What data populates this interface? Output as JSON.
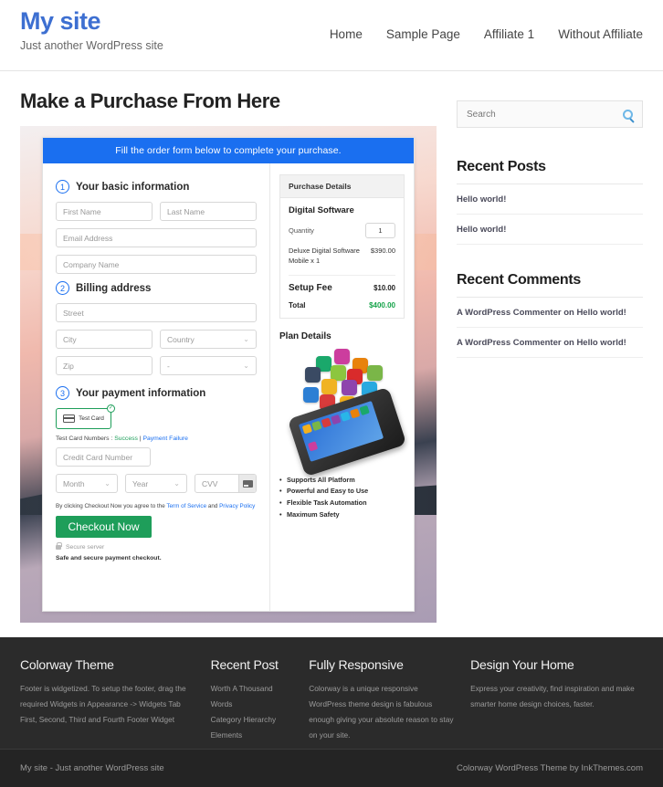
{
  "header": {
    "site_title": "My site",
    "tagline": "Just another WordPress site",
    "nav": [
      {
        "label": "Home"
      },
      {
        "label": "Sample Page"
      },
      {
        "label": "Affiliate 1"
      },
      {
        "label": "Without Affiliate"
      }
    ]
  },
  "page": {
    "title": "Make a Purchase From Here"
  },
  "form": {
    "banner": "Fill the order form below to complete your purchase.",
    "step1": {
      "number": "1",
      "label": "Your basic information",
      "first_name": "First Name",
      "last_name": "Last Name",
      "email": "Email Address",
      "company": "Company Name"
    },
    "step2": {
      "number": "2",
      "label": "Billing address",
      "street": "Street",
      "city": "City",
      "country": "Country",
      "zip": "Zip",
      "state": "-"
    },
    "step3": {
      "number": "3",
      "label": "Your payment information",
      "test_card_button": "Test Card",
      "test_card_badge": "✓",
      "test_numbers_label": "Test Card Numbers :",
      "success_link": "Success",
      "separator": "|",
      "failure_link": "Payment Failure",
      "credit_card_number": "Credit Card Number",
      "month": "Month",
      "year": "Year",
      "cvv": "CVV"
    },
    "terms_prefix": "By clicking Checkout Now you agree to the",
    "terms_link": "Term of Service",
    "terms_and": "and",
    "privacy_link": "Privacy Policy",
    "checkout_button": "Checkout Now",
    "secure_server": "Secure server",
    "safe_note": "Safe and secure payment checkout."
  },
  "purchase_details": {
    "header": "Purchase Details",
    "product_title": "Digital Software",
    "quantity_label": "Quantity",
    "quantity_value": "1",
    "item_name": "Deluxe Digital Software Mobile x 1",
    "item_price": "$390.00",
    "setup_fee_label": "Setup Fee",
    "setup_fee_value": "$10.00",
    "total_label": "Total",
    "total_value": "$400.00",
    "total_color": "#16a34a"
  },
  "plan_details": {
    "title": "Plan Details",
    "features": [
      "Supports All Platform",
      "Powerful and Easy to Use",
      "Flexible Task Automation",
      "Maximum Safety"
    ]
  },
  "sidebar": {
    "search_placeholder": "Search",
    "recent_posts_title": "Recent Posts",
    "recent_posts": [
      {
        "label": "Hello world!"
      },
      {
        "label": "Hello world!"
      }
    ],
    "recent_comments_title": "Recent Comments",
    "recent_comments": [
      {
        "label": "A WordPress Commenter on Hello world!"
      },
      {
        "label": "A WordPress Commenter on Hello world!"
      }
    ]
  },
  "footer": {
    "columns": [
      {
        "title": "Colorway Theme",
        "text": "Footer is widgetized. To setup the footer, drag the required Widgets in Appearance -> Widgets Tab First, Second, Third and Fourth Footer Widget"
      },
      {
        "title": "Recent Post",
        "items": [
          {
            "label": "Worth A Thousand Words"
          },
          {
            "label": "Category Hierarchy"
          },
          {
            "label": "Elements"
          }
        ]
      },
      {
        "title": "Fully Responsive",
        "text": "Colorway is a unique responsive WordPress theme design is fabulous enough giving your absolute reason to stay on your site."
      },
      {
        "title": "Design Your Home",
        "text": "Express your creativity, find inspiration and make smarter home design choices, faster."
      }
    ],
    "bottom_left": "My site - Just another WordPress site",
    "bottom_right": "Colorway WordPress Theme by InkThemes.com"
  }
}
